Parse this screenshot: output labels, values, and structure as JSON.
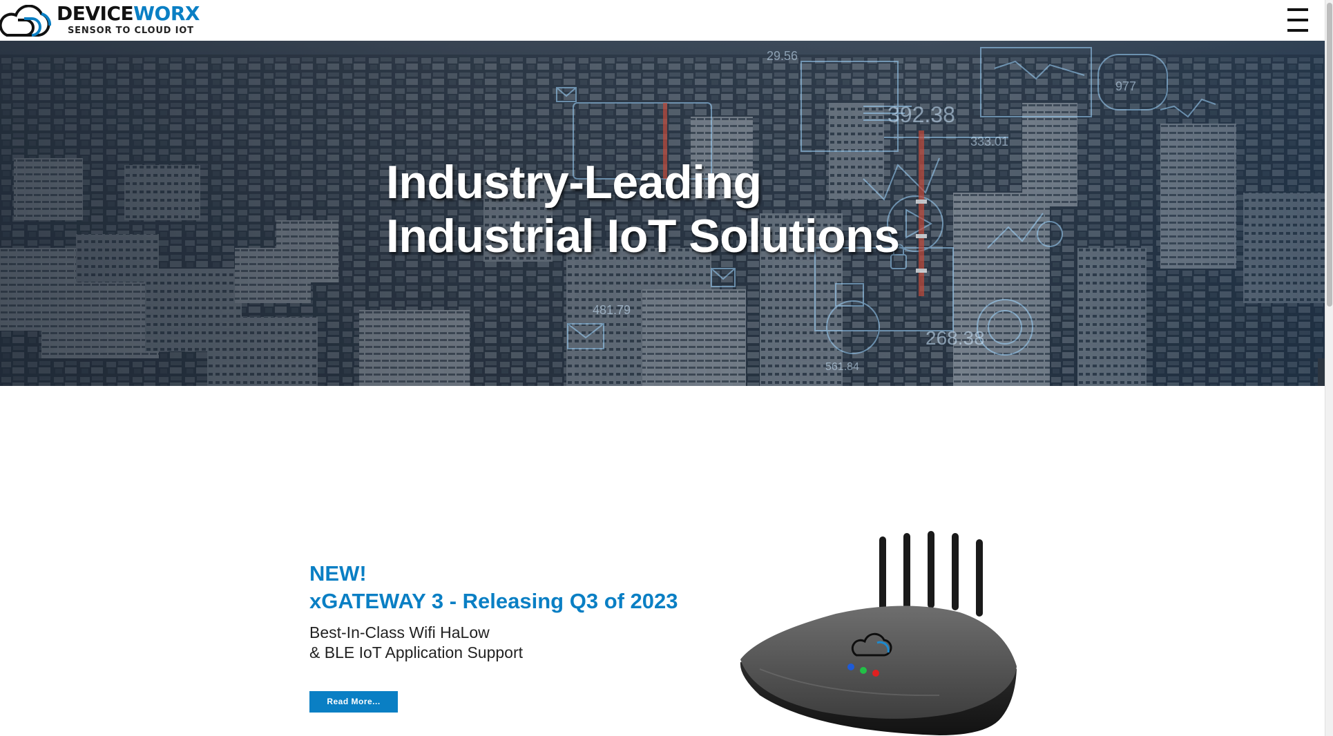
{
  "header": {
    "logo_name_part1": "DEVICE",
    "logo_name_part2": "WORX",
    "logo_tagline": "SENSOR TO CLOUD IOT",
    "menu_icon": "hamburger-menu-icon"
  },
  "hero": {
    "title_line1": "Industry-Leading",
    "title_line2": "Industrial IoT Solutions",
    "overlay_readings": [
      "29.56",
      "392.38",
      "333.01",
      "977",
      "481.79",
      "268.38",
      "561.84"
    ]
  },
  "product": {
    "badge": "NEW!",
    "title": "xGATEWAY 3 - Releasing Q3 of 2023",
    "desc_line1": "Best-In-Class Wifi HaLow",
    "desc_line2": "& BLE IoT Application Support",
    "cta_label": "Read More...",
    "led_colors": [
      "#1e5bd8",
      "#22c046",
      "#e02020"
    ]
  },
  "colors": {
    "brand_blue": "#0a7fc4",
    "text_dark": "#222222"
  }
}
